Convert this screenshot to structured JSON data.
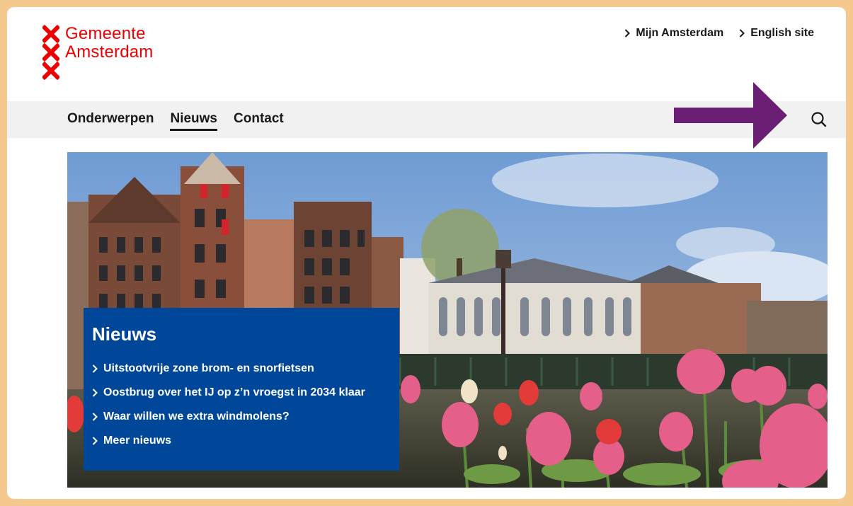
{
  "brand": {
    "line1": "Gemeente",
    "line2": "Amsterdam",
    "color": "#ec0000"
  },
  "top_links": [
    {
      "label": "Mijn Amsterdam",
      "icon": "chevron-right-icon"
    },
    {
      "label": "English site",
      "icon": "chevron-right-icon"
    }
  ],
  "nav": {
    "items": [
      {
        "label": "Onderwerpen",
        "active": false
      },
      {
        "label": "Nieuws",
        "active": true
      },
      {
        "label": "Contact",
        "active": false
      }
    ],
    "search_icon": "search-icon"
  },
  "annotation": {
    "arrow_color": "#6b1f74",
    "arrow_icon": "arrow-right-icon"
  },
  "news": {
    "title": "Nieuws",
    "background": "#004699",
    "items": [
      "Uitstootvrije zone brom- en snorfietsen",
      "Oostbrug over het IJ op z’n vroegst in 2034 klaar",
      "Waar willen we extra windmolens?",
      "Meer nieuws"
    ]
  },
  "colors": {
    "frame_border": "#f5c88e",
    "navbar_bg": "#f1f1f1",
    "text": "#1a1a1a"
  }
}
